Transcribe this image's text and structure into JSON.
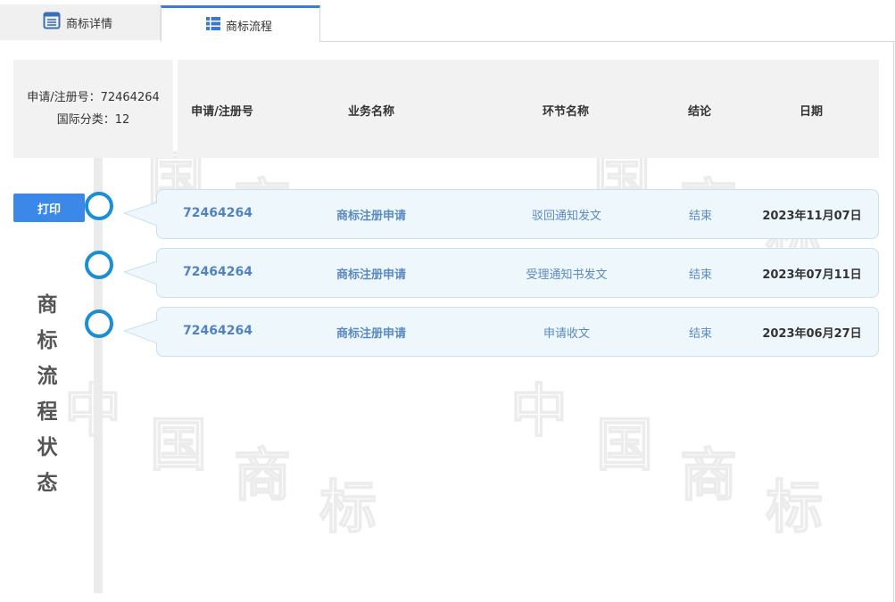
{
  "tabs": {
    "detail_label": "商标详情",
    "flow_label": "商标流程"
  },
  "info": {
    "reg_line": "申请/注册号：72464264",
    "class_line": "国际分类：12"
  },
  "table_headers": [
    "申请/注册号",
    "业务名称",
    "环节名称",
    "结论",
    "日期"
  ],
  "print_label": "打印",
  "side_label": [
    "商",
    "标",
    "流",
    "程",
    "状",
    "态"
  ],
  "rows": [
    {
      "reg_no": "72464264",
      "business": "商标注册申请",
      "step": "驳回通知发文",
      "result": "结束",
      "date": "2023年11月07日"
    },
    {
      "reg_no": "72464264",
      "business": "商标注册申请",
      "step": "受理通知书发文",
      "result": "结束",
      "date": "2023年07月11日"
    },
    {
      "reg_no": "72464264",
      "business": "商标注册申请",
      "step": "申请收文",
      "result": "结束",
      "date": "2023年06月27日"
    }
  ],
  "colors": {
    "accent": "#3b88e8",
    "timeline_circle": "#1b8fd1",
    "link_text": "#5b8ac2",
    "row_bg": "#eef7fb"
  }
}
